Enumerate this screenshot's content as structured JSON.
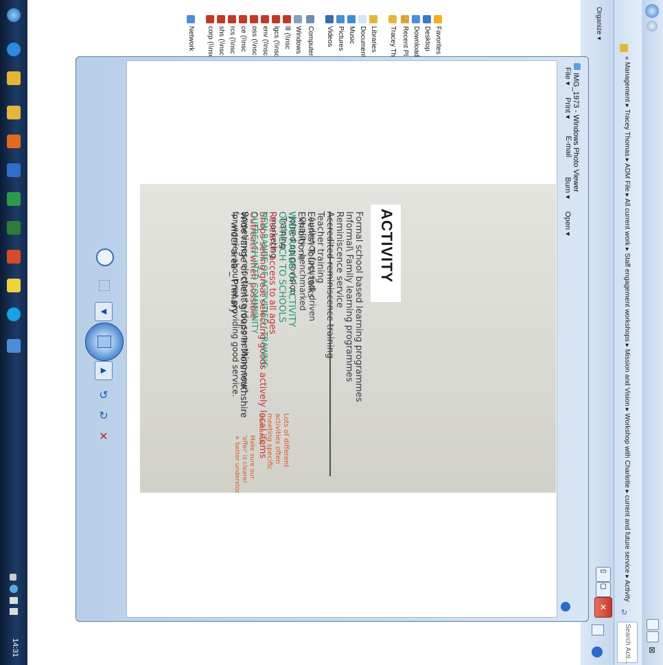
{
  "taskbar": {
    "clock": "14:31",
    "buttons": [
      "start-orb-icon",
      "ie-icon",
      "explorer-icon",
      "folder-icon",
      "outlook-icon",
      "word-icon",
      "excel-icon",
      "powerpoint-icon",
      "sticky-notes-icon",
      "skype-icon",
      "photo-viewer-icon"
    ]
  },
  "explorer": {
    "organize_label": "Organize ▾",
    "breadcrumb": "« Management ▸ Tracey Thomas ▸ ADM File ▸ All current work ▸ Staff engagement workshops ▸ Mission and Vision ▸ Workshop with Charlotte ▸ current and future service ▸ Activity",
    "search_placeholder": "Search Acti...",
    "nav": [
      {
        "label": "Favorites",
        "icon": "star-icon"
      },
      {
        "label": "Desktop",
        "icon": "desktop-icon"
      },
      {
        "label": "Downloads",
        "icon": "downloads-icon"
      },
      {
        "label": "Recent Places",
        "icon": "recent-places-icon"
      },
      {
        "label": "Tracey Thomas",
        "icon": "folder-icon"
      },
      {
        "label": "Libraries",
        "icon": "libraries-icon"
      },
      {
        "label": "Documents",
        "icon": "documents-icon"
      },
      {
        "label": "Music",
        "icon": "music-icon"
      },
      {
        "label": "Pictures",
        "icon": "pictures-icon"
      },
      {
        "label": "Videos",
        "icon": "videos-icon"
      },
      {
        "label": "Computer",
        "icon": "computer-icon"
      },
      {
        "label": "Windows",
        "icon": "drive-icon"
      },
      {
        "label": "lll (\\\\nsc",
        "icon": "network-drive-icon"
      },
      {
        "label": "lgcs (\\\\nsc",
        "icon": "network-drive-icon"
      },
      {
        "label": "env (\\\\nsc",
        "icon": "network-drive-icon"
      },
      {
        "label": "oss (\\\\nsc",
        "icon": "network-drive-icon"
      },
      {
        "label": "ce (\\\\nsc",
        "icon": "network-drive-icon"
      },
      {
        "label": "rcs (\\\\nsc",
        "icon": "network-drive-icon"
      },
      {
        "label": "shs (\\\\nsc",
        "icon": "network-drive-icon"
      },
      {
        "label": "corp (\\\\nsc",
        "icon": "network-drive-icon"
      },
      {
        "label": "Network",
        "icon": "network-icon"
      }
    ]
  },
  "viewer": {
    "title": "IMG_1973 - Windows Photo Viewer",
    "menu": [
      "File ▾",
      "Print ▾",
      "E-mail",
      "Burn ▾",
      "Open ▾"
    ]
  },
  "photo": {
    "heading": "ACTIVITY",
    "lines": [
      {
        "text": "Formal school based learning programmes",
        "color": "#3a3a45"
      },
      {
        "text": "Informal\\ Family learning programmes",
        "color": "#3a3a45"
      },
      {
        "text": "Reminiscence service",
        "color": "#3a3a45"
      },
      {
        "text": "Accredited reminiscence training",
        "color": "#3a3a45"
      },
      {
        "text": "Teacher training",
        "color": "#3a3a45"
      },
      {
        "text": "Events\\ Tours\\ talks",
        "color": "#3a3a45"
      },
      {
        "text": "Exhibitions",
        "color": "#3a3a45"
      },
      {
        "text": "WIDE RANGE OF ACTIVITY",
        "color": "#1c9a78"
      },
      {
        "text": "OUTREACH TO SCHOOLS",
        "color": "#1c9a78"
      },
      {
        "text": "Research access to all ages",
        "color": "#c9313a"
      },
      {
        "text": "Shops selling great selecting goods actively local items",
        "color": "#c9313a"
      },
      {
        "text": "Outreach when possible",
        "color": "#c9313a"
      },
      {
        "text": "Wide range of client groups in Monmouthshire",
        "color": "#2c2c35"
      },
      {
        "text": "+ wider area _ Primary",
        "color": "#2c2c35"
      }
    ],
    "lines2": [
      {
        "text": "· Audience focused\\ driven",
        "color": "#3a3a45"
      },
      {
        "text": "· Quality - benchmarked",
        "color": "#3a3a45"
      },
      {
        "text": "· Joined up provision",
        "color": "#3a3a45"
      },
      {
        "text": "· Training",
        "color": "#3a3a45"
      },
      {
        "text": "· marketing",
        "color": "#3a3a45"
      },
      {
        "text": "NEW RANGE OF ACTIVITIES / TRAWNG",
        "color": "#1c9a78"
      },
      {
        "text": "OUTREACH INTO COMMUNITY",
        "color": "#1c9a78"
      },
      {
        "text": "Sometimes reluctant to 'do something new'",
        "color": "#2c2c35"
      },
      {
        "text": "for worries about not providing good service.",
        "color": "#2c2c35"
      }
    ],
    "note1": [
      "Lots of different",
      "activities often",
      "meeting specific",
      "demands"
    ],
    "note2": [
      "Make sure our",
      "'offer' is clearer",
      "+ better understood."
    ]
  }
}
